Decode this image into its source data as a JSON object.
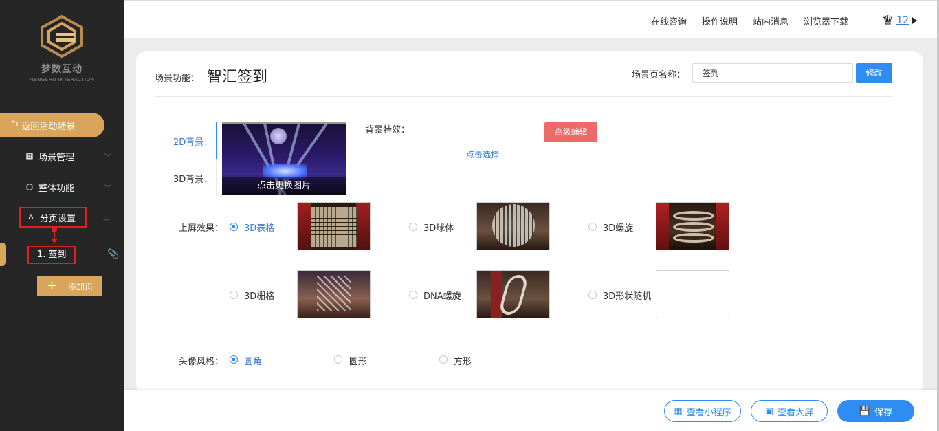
{
  "sidebar": {
    "logo_cn": "梦数互动",
    "logo_en": "MENGSHU INTERACTION",
    "back_label": "返回活动场景",
    "items": [
      {
        "label": "场景管理"
      },
      {
        "label": "整体功能"
      },
      {
        "label": "分页设置"
      }
    ],
    "sub_item_label": "1. 签到",
    "add_page_label": "添加页"
  },
  "header": {
    "links": [
      "在线咨询",
      "操作说明",
      "站内消息",
      "浏览器下载"
    ],
    "user_number": "12"
  },
  "scene": {
    "func_label": "场景功能：",
    "title": "智汇签到",
    "name_label": "场景页名称：",
    "name_value": "签到",
    "edit_label": "修改"
  },
  "background": {
    "tab_2d": "2D背景：",
    "tab_3d": "3D背景：",
    "change_image": "点击更换图片",
    "effect_label": "背景特效：",
    "advanced_edit": "高级编辑",
    "click_select": "点击选择"
  },
  "screen_effect": {
    "label": "上屏效果：",
    "selected": "3D表格",
    "options": [
      "3D表格",
      "3D球体",
      "3D螺旋",
      "3D栅格",
      "DNA螺旋",
      "3D形状随机"
    ]
  },
  "avatar_style": {
    "label": "头像风格：",
    "selected": "圆角",
    "options": [
      "圆角",
      "圆形",
      "方形"
    ]
  },
  "footer": {
    "mini_program": "查看小程序",
    "big_screen": "查看大屏",
    "save": "保存"
  },
  "colors": {
    "accent": "#2f8cf0",
    "gold": "#d9a55d",
    "sidebar_bg": "#262626",
    "highlight_red": "#e02020",
    "advanced_btn": "#ee6a6a"
  }
}
